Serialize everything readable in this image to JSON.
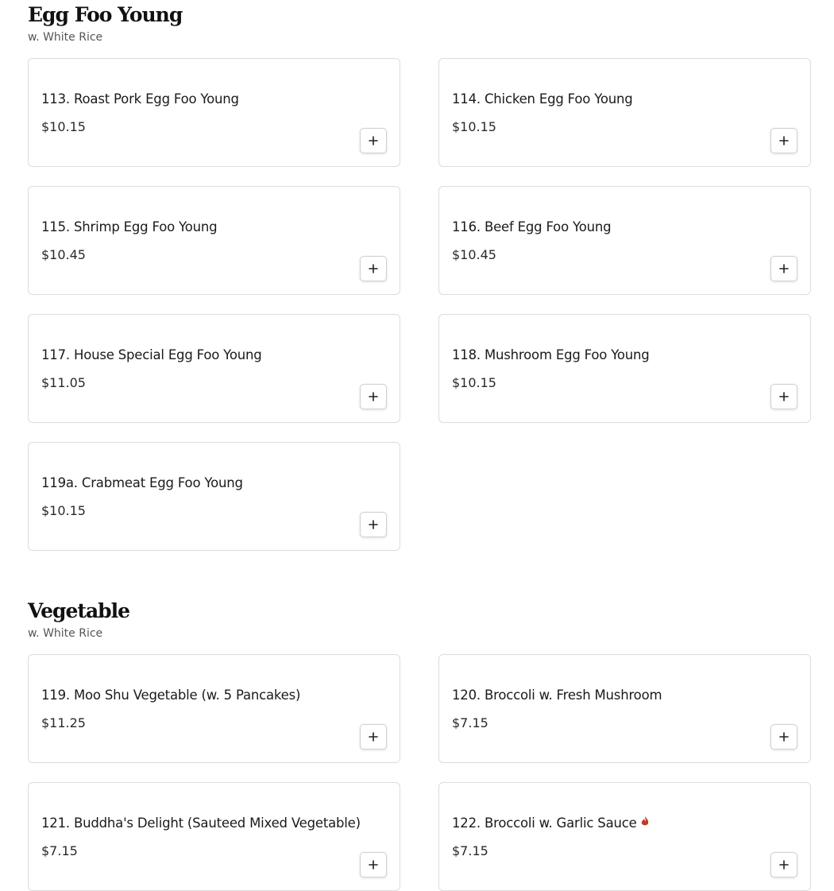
{
  "sections": [
    {
      "title": "Egg Foo Young",
      "subtitle": "w. White Rice",
      "items": [
        {
          "name": "113. Roast Pork Egg Foo Young",
          "price": "$10.15"
        },
        {
          "name": "114. Chicken Egg Foo Young",
          "price": "$10.15"
        },
        {
          "name": "115. Shrimp Egg Foo Young",
          "price": "$10.45"
        },
        {
          "name": "116. Beef Egg Foo Young",
          "price": "$10.45"
        },
        {
          "name": "117. House Special Egg Foo Young",
          "price": "$11.05"
        },
        {
          "name": "118. Mushroom Egg Foo Young",
          "price": "$10.15"
        },
        {
          "name": "119a. Crabmeat Egg Foo Young",
          "price": "$10.15"
        }
      ]
    },
    {
      "title": "Vegetable",
      "subtitle": "w. White Rice",
      "items": [
        {
          "name": "119. Moo Shu Vegetable (w. 5 Pancakes)",
          "price": "$11.25"
        },
        {
          "name": "120. Broccoli w. Fresh Mushroom",
          "price": "$7.15"
        },
        {
          "name": "121. Buddha's Delight (Sauteed Mixed Vegetable)",
          "price": "$7.15"
        },
        {
          "name": "122. Broccoli w. Garlic Sauce",
          "price": "$7.15",
          "spicy": true
        }
      ]
    }
  ],
  "icons": {
    "add": "plus-icon",
    "spicy": "chili-pepper-icon"
  },
  "colors": {
    "spicy": "#c0392b",
    "card_border": "#dcdcdc"
  }
}
